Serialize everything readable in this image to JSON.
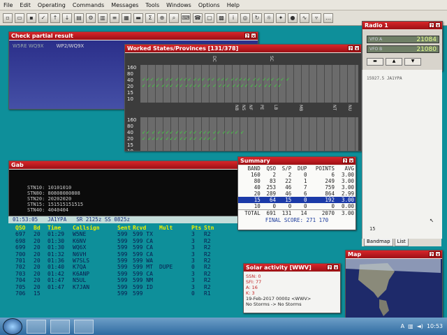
{
  "menu": [
    "File",
    "Edit",
    "Operating",
    "Commands",
    "Messages",
    "Tools",
    "Windows",
    "Options",
    "Help"
  ],
  "partial": {
    "title": "Check partial result",
    "items": [
      "W5RE WQ9X",
      "WP2/WQ9X"
    ]
  },
  "worked": {
    "title": "Worked States/Provinces [131/378]",
    "bands": [
      "160",
      "80",
      "40",
      "20",
      "15",
      "10"
    ]
  },
  "gab": {
    "title": "Gab",
    "lines": [
      "STN10: 10101010",
      "STN80: 80808080808",
      "STN20: 20202020",
      "STN15: 151515151515",
      "STN40: 4040404"
    ]
  },
  "summary": {
    "title": "Summary",
    "headers": [
      "BAND",
      "QSO",
      "S/P",
      "DUP",
      "POINTS",
      "AVG"
    ],
    "rows": [
      [
        "160",
        "2",
        "2",
        "0",
        "6",
        "3.00"
      ],
      [
        "80",
        "83",
        "22",
        "1",
        "249",
        "3.00"
      ],
      [
        "40",
        "253",
        "46",
        "7",
        "759",
        "3.00"
      ],
      [
        "20",
        "289",
        "46",
        "6",
        "864",
        "2.99"
      ],
      [
        "15",
        "64",
        "15",
        "0",
        "192",
        "3.00"
      ],
      [
        "10",
        "0",
        "0",
        "0",
        "0",
        "0.00"
      ]
    ],
    "total": [
      "TOTAL",
      "691",
      "131",
      "14",
      "2070",
      "3.00"
    ],
    "final": "FINAL SCORE: 271 170"
  },
  "status": {
    "time": "01:53:05",
    "call": "JA1YPA",
    "sr": "SR 2125z SS 0825z"
  },
  "log": {
    "headers": [
      "QSO",
      "Bd",
      "Time",
      "Callsign",
      "Sent",
      "Rcvd",
      "Mult",
      "Pts",
      "Stn"
    ],
    "rows": [
      [
        "697",
        "20",
        "01:29",
        "W5NE",
        "599",
        "599 TX",
        "",
        "3",
        "R2"
      ],
      [
        "698",
        "20",
        "01:30",
        "K6NV",
        "599",
        "599 CA",
        "",
        "3",
        "R2"
      ],
      [
        "699",
        "20",
        "01:30",
        "WQ6X",
        "599",
        "599 CA",
        "",
        "3",
        "R2"
      ],
      [
        "700",
        "20",
        "01:32",
        "N6VH",
        "599",
        "599 CA",
        "",
        "3",
        "R2"
      ],
      [
        "701",
        "20",
        "01:36",
        "W7SLS",
        "599",
        "599 WA",
        "",
        "3",
        "R2"
      ],
      [
        "702",
        "20",
        "01:40",
        "K7QA",
        "599",
        "599 MT",
        "DUPE",
        "0",
        "R2"
      ],
      [
        "703",
        "20",
        "01:42",
        "K6ANP",
        "599",
        "599 CA",
        "",
        "3",
        "R2"
      ],
      [
        "704",
        "20",
        "01:47",
        "N5UL",
        "599",
        "599 NM",
        "",
        "3",
        "R2"
      ],
      [
        "705",
        "20",
        "01:47",
        "K7JAN",
        "599",
        "599 ID",
        "",
        "3",
        "R2"
      ],
      [
        "706",
        "15",
        "",
        "",
        "599",
        "599",
        "",
        "0",
        "R1"
      ]
    ]
  },
  "radio": {
    "title": "Radio 1",
    "vfo_a": "21084",
    "vfo_b": "21080",
    "spot": "15927.5 JA1YPA",
    "counter": "15"
  },
  "bandmap_tabs": [
    "Bandmap",
    "List"
  ],
  "solar": {
    "title": "Solar activity [WWV]",
    "lines": [
      "SSN: 0",
      "SFI: 77",
      "A: 16",
      "K: 3"
    ],
    "date": "19-Feb-2017 0000z <WWV>",
    "storm": "No Storms -> No Storms"
  },
  "map": {
    "title": "Map"
  },
  "clock": "10:53",
  "colors": {
    "accent": "#c61b1f",
    "selected": "#1b3aa8",
    "desktop": "#0e8f9a"
  }
}
